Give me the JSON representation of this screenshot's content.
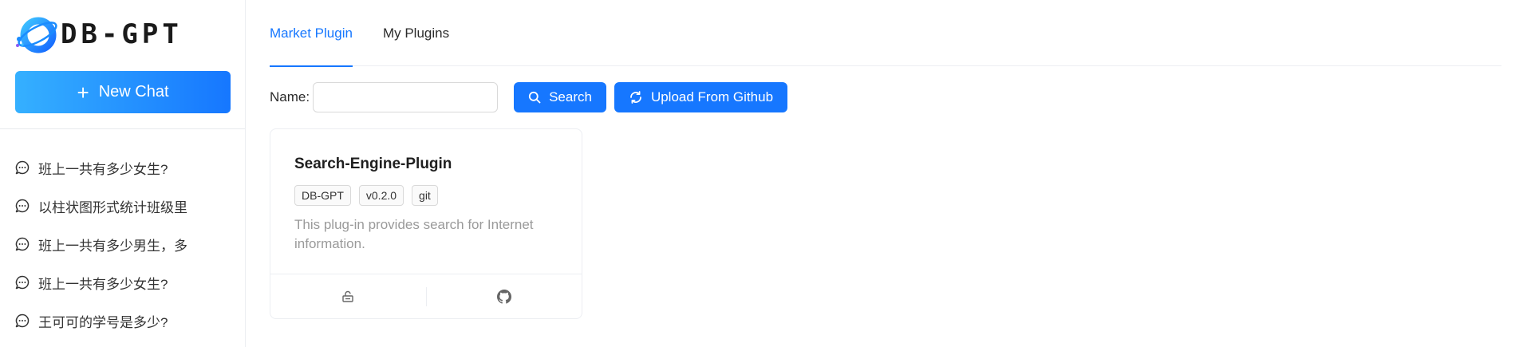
{
  "app": {
    "logo_text": "DB-GPT"
  },
  "sidebar": {
    "new_chat_label": "New Chat",
    "history": [
      {
        "label": "班上一共有多少女生?"
      },
      {
        "label": "以柱状图形式统计班级里"
      },
      {
        "label": "班上一共有多少男生，多"
      },
      {
        "label": "班上一共有多少女生?"
      },
      {
        "label": "王可可的学号是多少?"
      }
    ]
  },
  "main": {
    "tabs": [
      {
        "label": "Market Plugin",
        "active": true
      },
      {
        "label": "My Plugins",
        "active": false
      }
    ],
    "filter": {
      "name_label": "Name:",
      "name_value": "",
      "search_button": "Search",
      "upload_button": "Upload From Github"
    },
    "plugins": [
      {
        "title": "Search-Engine-Plugin",
        "tags": [
          "DB-GPT",
          "v0.2.0",
          "git"
        ],
        "description": "This plug-in provides search for Internet information.",
        "actions": [
          "install-icon",
          "github-icon"
        ]
      }
    ]
  },
  "colors": {
    "accent": "#1677ff",
    "gradient_start": "#35b0ff",
    "muted_text": "#9a9a9a"
  }
}
